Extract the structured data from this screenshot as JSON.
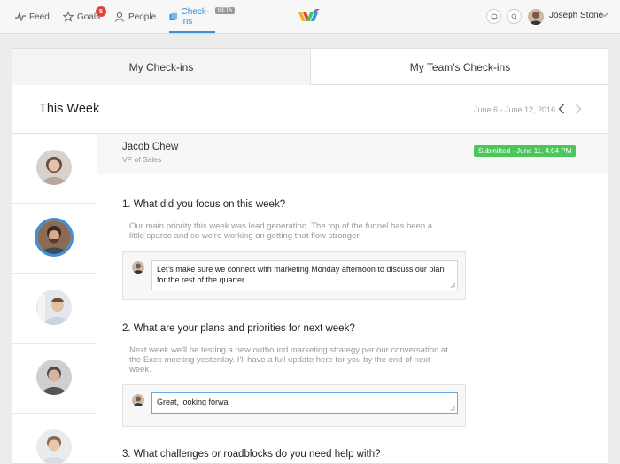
{
  "nav": {
    "items": [
      {
        "label": "Feed",
        "icon": "activity-icon"
      },
      {
        "label": "Goals",
        "icon": "star-icon",
        "badge": "5"
      },
      {
        "label": "People",
        "icon": "person-icon"
      },
      {
        "label": "Check-ins",
        "icon": "checkin-icon",
        "tag": "BETA",
        "active": true
      }
    ],
    "user": {
      "name": "Joseph Stone"
    }
  },
  "tabs": [
    {
      "label": "My Check-ins",
      "active": false
    },
    {
      "label": "My Team's Check-ins",
      "active": true
    }
  ],
  "week": {
    "title": "This Week",
    "range": "June 6 - June 12, 2016"
  },
  "person": {
    "name": "Jacob Chew",
    "title": "VP of Sales",
    "status": "Submitted - June 11, 4:04 PM"
  },
  "questions": [
    {
      "text": "1. What did you focus on this week?",
      "answer": "Our main priority this week was lead generation. The top of the funnel has been a little sparse and so we're working on getting that flow stronger.",
      "comment": "Let's make sure we connect with marketing Monday afternoon to discuss our plan for the rest of the quarter."
    },
    {
      "text": "2. What are your plans and priorities for next week?",
      "answer": "Next week we'll be testing a new outbound marketing strategy per our conversation at the Exec meeting yesterday. I'll have a full update here for you by the end of next week.",
      "comment": "Great, looking forwa"
    },
    {
      "text": "3. What challenges or roadblocks do you need help with?"
    }
  ],
  "colors": {
    "accent": "#3a8fd8",
    "success": "#4cc55b",
    "badge": "#e0433a"
  }
}
